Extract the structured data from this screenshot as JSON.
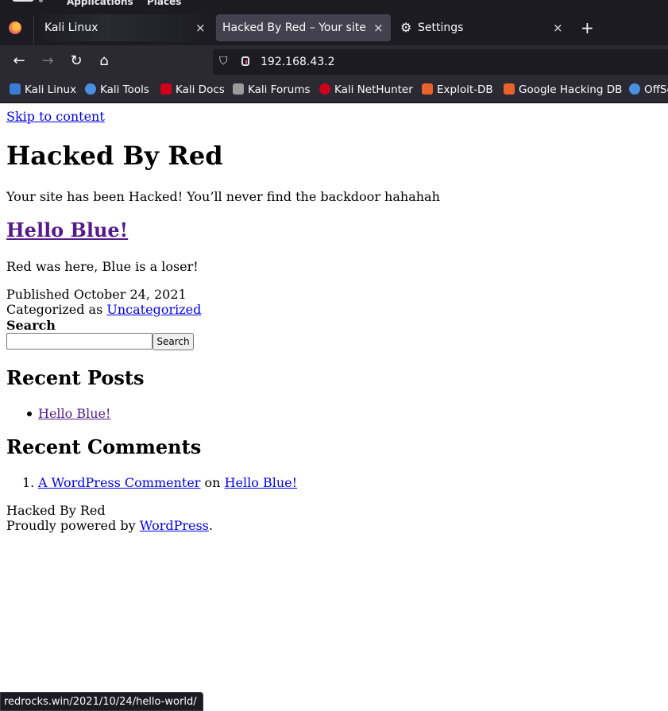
{
  "system_bar": {
    "applications": "Applications",
    "places": "Places"
  },
  "tabs": [
    {
      "label": "Kali Linux",
      "close": "×"
    },
    {
      "label": "Hacked By Red – Your site has been Hacked!",
      "close": "×"
    },
    {
      "label": "Settings",
      "close": "×"
    }
  ],
  "new_tab": "+",
  "nav": {
    "back": "←",
    "forward": "→",
    "reload": "↻",
    "home": "⌂"
  },
  "url": "192.168.43.2",
  "bookmarks": [
    {
      "label": "Kali Linux",
      "color": "#3a7bd5"
    },
    {
      "label": "Kali Tools",
      "color": "#4a90e2"
    },
    {
      "label": "Kali Docs",
      "color": "#d0021b"
    },
    {
      "label": "Kali Forums",
      "color": "#9b9b9b"
    },
    {
      "label": "Kali NetHunter",
      "color": "#d0021b"
    },
    {
      "label": "Exploit-DB",
      "color": "#e8632b"
    },
    {
      "label": "Google Hacking DB",
      "color": "#e8632b"
    },
    {
      "label": "OffSec",
      "color": "#4a90e2"
    }
  ],
  "page": {
    "skip_link": "Skip to content",
    "site_title": "Hacked By Red",
    "tagline": "Your site has been Hacked! You’ll never find the backdoor hahahah",
    "post_title": "Hello Blue!",
    "post_content": "Red was here, Blue is a loser!",
    "published_label": "Published",
    "published_date": "October 24, 2021",
    "categorized_label": "Categorized as",
    "category": "Uncategorized",
    "search_label": "Search",
    "search_button": "Search",
    "recent_posts_heading": "Recent Posts",
    "recent_posts": [
      "Hello Blue!"
    ],
    "recent_comments_heading": "Recent Comments",
    "comment": {
      "number": "1.",
      "author": "A WordPress Commenter",
      "on": "on",
      "post": "Hello Blue!"
    },
    "footer_title": "Hacked By Red",
    "footer_powered": "Proudly powered by",
    "footer_link": "WordPress",
    "footer_period": "."
  },
  "status_url": "redrocks.win/2021/10/24/hello-world/"
}
